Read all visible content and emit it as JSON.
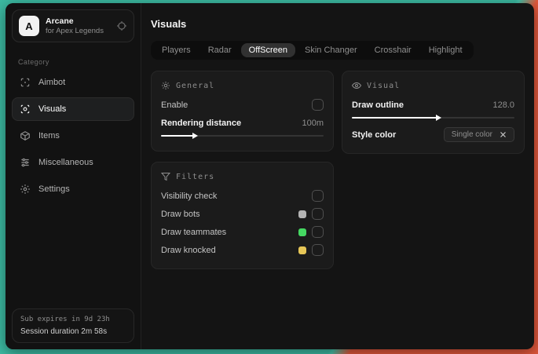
{
  "sidebar": {
    "brand": {
      "initial": "A",
      "title": "Arcane",
      "subtitle": "for Apex Legends"
    },
    "category_label": "Category",
    "items": [
      {
        "label": "Aimbot"
      },
      {
        "label": "Visuals"
      },
      {
        "label": "Items"
      },
      {
        "label": "Miscellaneous"
      },
      {
        "label": "Settings"
      }
    ],
    "footer": {
      "expiry": "Sub expires in 9d 23h",
      "session": "Session duration 2m 58s"
    }
  },
  "header": {
    "title": "Visuals"
  },
  "tabs": [
    {
      "label": "Players"
    },
    {
      "label": "Radar"
    },
    {
      "label": "OffScreen"
    },
    {
      "label": "Skin Changer"
    },
    {
      "label": "Crosshair"
    },
    {
      "label": "Highlight"
    }
  ],
  "active_tab": "OffScreen",
  "panels": {
    "general": {
      "title": "General",
      "enable_label": "Enable",
      "rendering_distance_label": "Rendering distance",
      "rendering_distance_value": "100m",
      "rendering_distance_fill": "20%"
    },
    "visual": {
      "title": "Visual",
      "draw_outline_label": "Draw outline",
      "draw_outline_value": "128.0",
      "draw_outline_fill": "52%",
      "style_color_label": "Style color",
      "style_color_value": "Single color"
    },
    "filters": {
      "title": "Filters",
      "rows": [
        {
          "label": "Visibility check",
          "swatch": ""
        },
        {
          "label": "Draw bots",
          "swatch": "#b3b3b3"
        },
        {
          "label": "Draw teammates",
          "swatch": "#45d862"
        },
        {
          "label": "Draw knocked",
          "swatch": "#e6c657"
        }
      ]
    }
  },
  "colors": {
    "desktop_teal": "#3cbaa2",
    "desktop_red": "#e0573b",
    "window_bg": "#141414",
    "panel_bg": "#1b1b1b",
    "accent_fill": "#ffffff"
  }
}
